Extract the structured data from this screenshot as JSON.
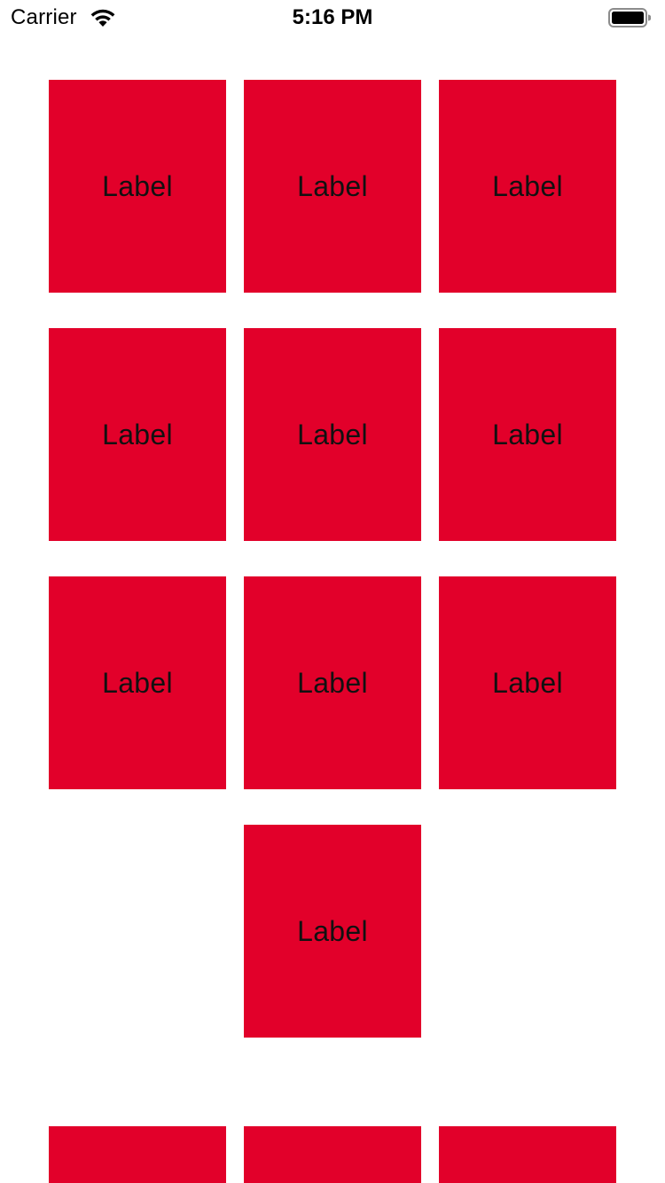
{
  "status_bar": {
    "carrier": "Carrier",
    "time": "5:16 PM",
    "wifi_icon": "wifi-icon",
    "battery_icon": "battery-icon"
  },
  "accent_color": "#e2002a",
  "grid": {
    "rows": [
      {
        "items": [
          {
            "label": "Label"
          },
          {
            "label": "Label"
          },
          {
            "label": "Label"
          }
        ]
      },
      {
        "items": [
          {
            "label": "Label"
          },
          {
            "label": "Label"
          },
          {
            "label": "Label"
          }
        ]
      },
      {
        "items": [
          {
            "label": "Label"
          },
          {
            "label": "Label"
          },
          {
            "label": "Label"
          }
        ]
      },
      {
        "items": [
          {
            "label": "Label"
          }
        ]
      }
    ]
  }
}
